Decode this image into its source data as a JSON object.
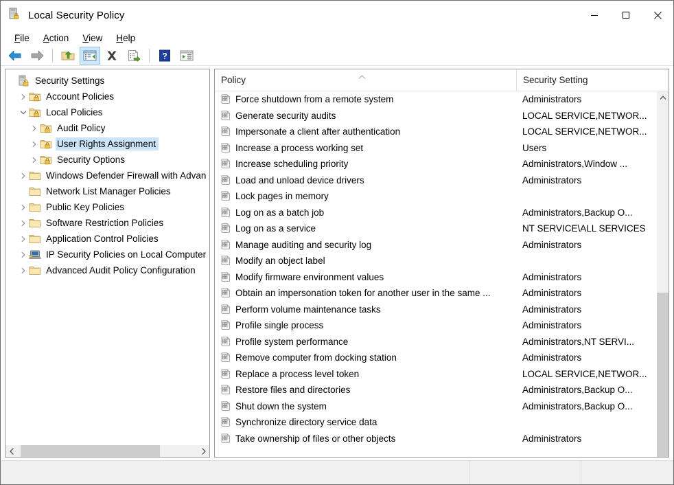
{
  "window": {
    "title": "Local Security Policy",
    "icon": "security-policy-icon",
    "controls": {
      "minimize": "minimize-icon",
      "maximize": "maximize-icon",
      "close": "close-icon"
    }
  },
  "menubar": {
    "items": [
      {
        "label": "File",
        "accel": "F"
      },
      {
        "label": "Action",
        "accel": "A"
      },
      {
        "label": "View",
        "accel": "V"
      },
      {
        "label": "Help",
        "accel": "H"
      }
    ]
  },
  "toolbar": {
    "buttons": [
      {
        "name": "back-icon",
        "active": false
      },
      {
        "name": "forward-icon",
        "active": false
      },
      {
        "name": "up-folder-icon",
        "active": false
      },
      {
        "name": "show-hide-console-tree-icon",
        "active": true
      },
      {
        "name": "delete-icon",
        "active": false
      },
      {
        "name": "export-list-icon",
        "active": false
      },
      {
        "name": "help-icon",
        "active": false
      },
      {
        "name": "show-action-pane-icon",
        "active": false
      }
    ]
  },
  "tree": {
    "items": [
      {
        "label": "Security Settings",
        "depth": 0,
        "twisty": "none",
        "icon": "security-settings-icon",
        "selected": false
      },
      {
        "label": "Account Policies",
        "depth": 1,
        "twisty": "collapsed",
        "icon": "policy-folder-icon",
        "selected": false
      },
      {
        "label": "Local Policies",
        "depth": 1,
        "twisty": "expanded",
        "icon": "policy-folder-icon",
        "selected": false
      },
      {
        "label": "Audit Policy",
        "depth": 2,
        "twisty": "collapsed",
        "icon": "policy-folder-icon",
        "selected": false
      },
      {
        "label": "User Rights Assignment",
        "depth": 2,
        "twisty": "collapsed",
        "icon": "policy-folder-icon",
        "selected": true
      },
      {
        "label": "Security Options",
        "depth": 2,
        "twisty": "collapsed",
        "icon": "policy-folder-icon",
        "selected": false
      },
      {
        "label": "Windows Defender Firewall with Advan",
        "depth": 1,
        "twisty": "collapsed",
        "icon": "plain-folder-icon",
        "selected": false
      },
      {
        "label": "Network List Manager Policies",
        "depth": 1,
        "twisty": "none",
        "icon": "plain-folder-icon",
        "selected": false
      },
      {
        "label": "Public Key Policies",
        "depth": 1,
        "twisty": "collapsed",
        "icon": "plain-folder-icon",
        "selected": false
      },
      {
        "label": "Software Restriction Policies",
        "depth": 1,
        "twisty": "collapsed",
        "icon": "plain-folder-icon",
        "selected": false
      },
      {
        "label": "Application Control Policies",
        "depth": 1,
        "twisty": "collapsed",
        "icon": "plain-folder-icon",
        "selected": false
      },
      {
        "label": "IP Security Policies on Local Computer",
        "depth": 1,
        "twisty": "collapsed",
        "icon": "ip-security-icon",
        "selected": false
      },
      {
        "label": "Advanced Audit Policy Configuration",
        "depth": 1,
        "twisty": "collapsed",
        "icon": "plain-folder-icon",
        "selected": false
      }
    ],
    "hscrollbar": {
      "left_arrow": "chevron-left-icon",
      "right_arrow": "chevron-right-icon"
    }
  },
  "list": {
    "columns": [
      {
        "label": "Policy",
        "sorted": "ascending"
      },
      {
        "label": "Security Setting",
        "sorted": "none"
      }
    ],
    "rows": [
      {
        "policy": "Force shutdown from a remote system",
        "setting": "Administrators"
      },
      {
        "policy": "Generate security audits",
        "setting": "LOCAL SERVICE,NETWOR..."
      },
      {
        "policy": "Impersonate a client after authentication",
        "setting": "LOCAL SERVICE,NETWOR..."
      },
      {
        "policy": "Increase a process working set",
        "setting": "Users"
      },
      {
        "policy": "Increase scheduling priority",
        "setting": "Administrators,Window ..."
      },
      {
        "policy": "Load and unload device drivers",
        "setting": "Administrators"
      },
      {
        "policy": "Lock pages in memory",
        "setting": ""
      },
      {
        "policy": "Log on as a batch job",
        "setting": "Administrators,Backup O..."
      },
      {
        "policy": "Log on as a service",
        "setting": "NT SERVICE\\ALL SERVICES"
      },
      {
        "policy": "Manage auditing and security log",
        "setting": "Administrators"
      },
      {
        "policy": "Modify an object label",
        "setting": ""
      },
      {
        "policy": "Modify firmware environment values",
        "setting": "Administrators"
      },
      {
        "policy": "Obtain an impersonation token for another user in the same ...",
        "setting": "Administrators"
      },
      {
        "policy": "Perform volume maintenance tasks",
        "setting": "Administrators"
      },
      {
        "policy": "Profile single process",
        "setting": "Administrators"
      },
      {
        "policy": "Profile system performance",
        "setting": "Administrators,NT SERVI..."
      },
      {
        "policy": "Remove computer from docking station",
        "setting": "Administrators"
      },
      {
        "policy": "Replace a process level token",
        "setting": "LOCAL SERVICE,NETWOR..."
      },
      {
        "policy": "Restore files and directories",
        "setting": "Administrators,Backup O..."
      },
      {
        "policy": "Shut down the system",
        "setting": "Administrators,Backup O..."
      },
      {
        "policy": "Synchronize directory service data",
        "setting": ""
      },
      {
        "policy": "Take ownership of files or other objects",
        "setting": "Administrators"
      }
    ],
    "vscrollbar": {
      "up_arrow": "chevron-up-icon",
      "down_arrow": "chevron-down-icon"
    }
  },
  "statusbar": {
    "main": "",
    "segment1": "",
    "segment2": ""
  },
  "colors": {
    "selection": "#cce4f7",
    "toolbar_active": "#cfe8f9",
    "scroll_thumb": "#cdcdcd",
    "scroll_track": "#f0f0f0",
    "frame": "#6d6d6d",
    "pane_border": "#9a9a9a"
  }
}
